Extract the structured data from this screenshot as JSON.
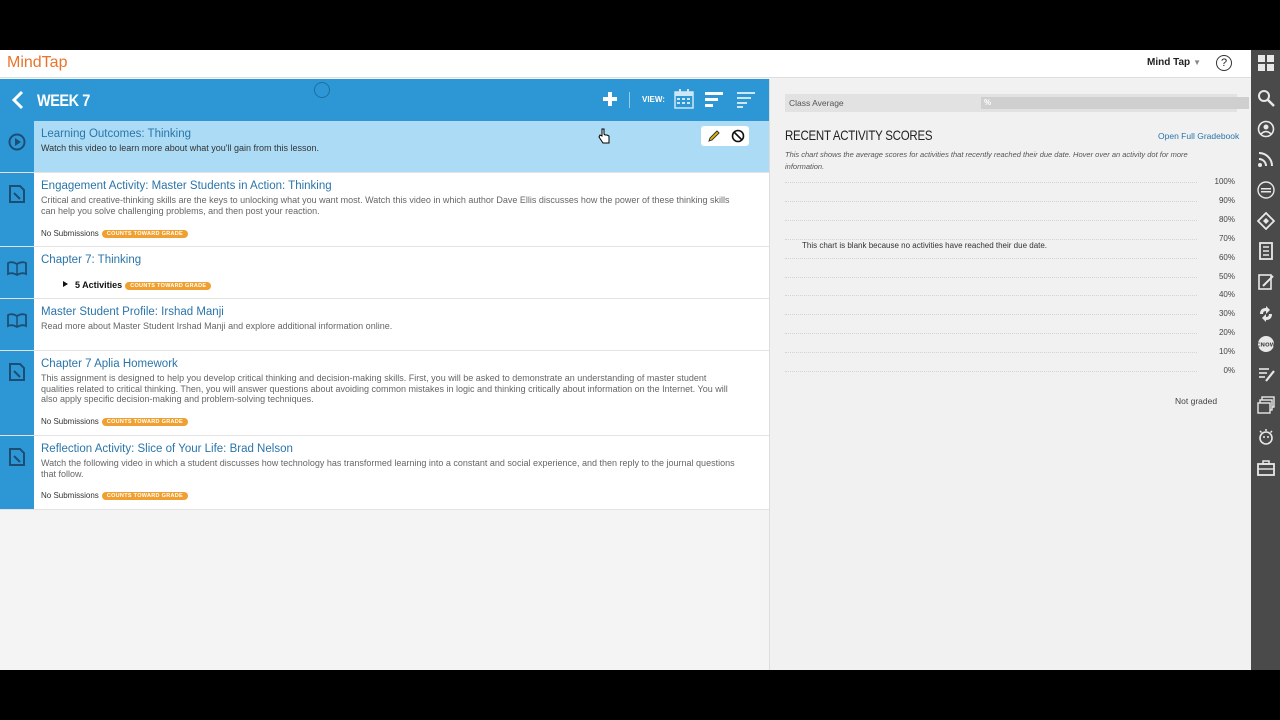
{
  "app": {
    "brand": "MindTap",
    "user_menu": "Mind Tap",
    "help": "?"
  },
  "week": {
    "title": "WEEK 7",
    "view_label": "VIEW:"
  },
  "activities": [
    {
      "title": "Learning Outcomes: Thinking",
      "description": "Watch this video to learn more about what you'll gain from this lesson.",
      "icon": "play-circle-icon",
      "selected": true
    },
    {
      "title": "Engagement Activity: Master Students in Action: Thinking",
      "description": "Critical and creative-thinking skills are the keys to unlocking what you want most. Watch this video in which author Dave Ellis discusses how the power of these thinking skills can help you solve challenging problems, and then post your reaction.",
      "icon": "document-edit-icon",
      "submissions": "No Submissions",
      "badge": "COUNTS TOWARD GRADE"
    },
    {
      "title": "Chapter 7: Thinking",
      "icon": "book-icon",
      "expander": "5 Activities",
      "badge": "COUNTS TOWARD GRADE"
    },
    {
      "title": "Master Student Profile: Irshad Manji",
      "description": "Read more about Master Student Irshad Manji and explore additional information online.",
      "icon": "book-icon"
    },
    {
      "title": "Chapter 7 Aplia Homework",
      "description": "This assignment is designed to help you develop critical thinking and decision-making skills. First, you will be asked to demonstrate an understanding of master student qualities related to critical thinking. Then, you will answer questions about avoiding common mistakes in logic and thinking critically about information on the Internet. You will also apply specific decision-making and problem-solving techniques.",
      "icon": "document-edit-icon",
      "submissions": "No Submissions",
      "badge": "COUNTS TOWARD GRADE"
    },
    {
      "title": "Reflection Activity: Slice of Your Life: Brad Nelson",
      "description": "Watch the following video in which a student discusses how technology has transformed learning into a constant and social experience, and then reply to the journal questions that follow.",
      "icon": "document-edit-icon",
      "submissions": "No Submissions",
      "badge": "COUNTS TOWARD GRADE"
    }
  ],
  "scores": {
    "class_average_label": "Class Average",
    "class_average_value": "%",
    "title": "RECENT ACTIVITY SCORES",
    "gradebook_link": "Open Full Gradebook",
    "description": "This chart shows the average scores for activities that recently reached their due date. Hover over an activity dot for more information.",
    "empty_message": "This chart is blank because no activities have reached their due date.",
    "ticks": [
      "100%",
      "90%",
      "80%",
      "70%",
      "60%",
      "50%",
      "40%",
      "30%",
      "20%",
      "10%",
      "0%"
    ],
    "not_graded": "Not graded"
  },
  "dock_icons": [
    "apps-grid-icon",
    "search-icon",
    "person-chat-icon",
    "rss-icon",
    "mastering-circle-icon",
    "diamond-sign-icon",
    "notebook-icon",
    "edit-document-icon",
    "share-arrows-icon",
    "cnow-badge-icon",
    "notes-edit-icon",
    "stacked-cards-icon",
    "sun-face-icon",
    "briefcase-icon"
  ],
  "colors": {
    "brand": "#e8742d",
    "header_blue": "#2d97d5",
    "selected_row": "#acdcf5",
    "badge_orange": "#f0a030",
    "link_blue": "#2a75aa",
    "dock": "#4a4a4a"
  }
}
